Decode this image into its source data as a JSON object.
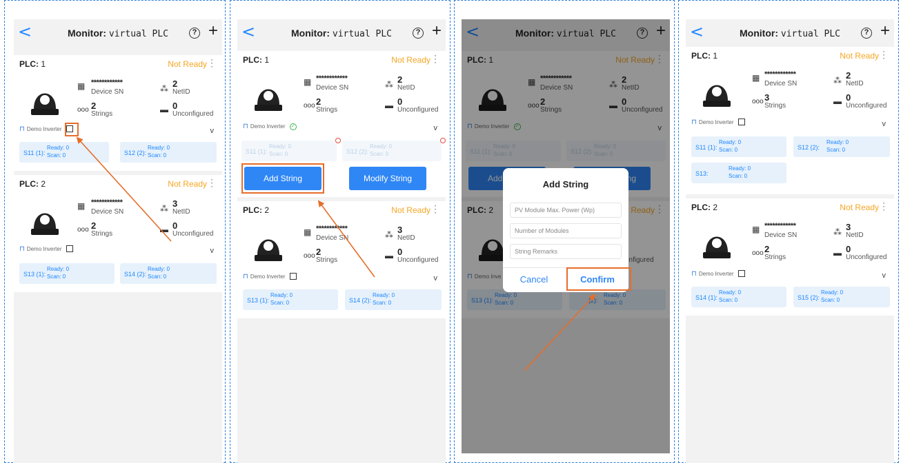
{
  "colors": {
    "accent": "#1e86ff",
    "status": "#f5a623",
    "annotation": "#e66d2a",
    "panel_border": "#2e7dd6"
  },
  "header": {
    "title_prefix": "Monitor:",
    "title_device": "virtual PLC",
    "back_icon": "chevron-left-icon",
    "help_icon": "question-circle-icon",
    "add_icon": "plus-icon",
    "help_glyph": "?",
    "add_glyph": "+",
    "back_glyph": "<"
  },
  "labels": {
    "plc": "PLC:",
    "device_sn": "Device SN",
    "sn_mask": "************",
    "netid": "NetID",
    "strings": "Strings",
    "unconfigured": "Unconfigured",
    "demo_inverter": "Demo Inverter",
    "ready_prefix": "Ready:",
    "scan_prefix": "Scan:",
    "chevron": "v",
    "kebab": "⋮"
  },
  "panels": [
    {
      "plcs": [
        {
          "id": "1",
          "status": "Not Ready",
          "netid": "2",
          "strings": "2",
          "unconfigured": "0",
          "demo_icon": "edit-icon",
          "tiles": [
            {
              "label": "S11 (1):",
              "ready": "Ready: 0",
              "scan": "Scan: 0"
            },
            {
              "label": "S12 (2):",
              "ready": "Ready: 0",
              "scan": "Scan: 0"
            }
          ]
        },
        {
          "id": "2",
          "status": "Not Ready",
          "netid": "3",
          "strings": "2",
          "unconfigured": "0",
          "demo_icon": "edit-icon",
          "tiles": [
            {
              "label": "S13 (1):",
              "ready": "Ready: 0",
              "scan": "Scan: 0"
            },
            {
              "label": "S14 (2):",
              "ready": "Ready: 0",
              "scan": "Scan: 0"
            }
          ]
        }
      ]
    },
    {
      "plcs": [
        {
          "id": "1",
          "status": "Not Ready",
          "netid": "2",
          "strings": "2",
          "unconfigured": "0",
          "demo_icon": "check-circle-icon",
          "tiles": [
            {
              "label": "S11 (1):",
              "ready": "Ready: 0",
              "scan": "Scan: 0"
            },
            {
              "label": "S12 (2):",
              "ready": "Ready: 0",
              "scan": "Scan: 0"
            }
          ],
          "buttons": {
            "add": "Add String",
            "modify": "Modify String"
          }
        },
        {
          "id": "2",
          "status": "Not Ready",
          "netid": "3",
          "strings": "2",
          "unconfigured": "0",
          "demo_icon": "edit-icon",
          "tiles": [
            {
              "label": "S13 (1):",
              "ready": "Ready: 0",
              "scan": "Scan: 0"
            },
            {
              "label": "S14 (2):",
              "ready": "Ready: 0",
              "scan": "Scan: 0"
            }
          ]
        }
      ]
    },
    {
      "plcs": [
        {
          "id": "1",
          "status": "Not Ready",
          "netid": "2",
          "strings": "2",
          "unconfigured": "0",
          "demo_icon": "check-circle-icon",
          "tiles": [
            {
              "label": "S11 (1):",
              "ready": "Ready: 0",
              "scan": "Scan: 0"
            },
            {
              "label": "S12 (2):",
              "ready": "Ready: 0",
              "scan": "Scan: 0"
            }
          ],
          "buttons": {
            "add": "Add String",
            "modify": "Modify String"
          }
        },
        {
          "id": "2",
          "status": "Ready",
          "netid": "",
          "strings": "",
          "unconfigured": "",
          "demo_icon": "edit-icon",
          "tiles": [
            {
              "label": "S13 (1):",
              "ready": "Ready: 0",
              "scan": "Scan: 0"
            },
            {
              "label": "(2):",
              "ready": "Ready: 0",
              "scan": "Scan: 0"
            }
          ],
          "partial_labels": {
            "netid": "ID",
            "unconfigured": "configured",
            "demo": "Demo Inve"
          }
        }
      ],
      "dialog": {
        "title": "Add String",
        "fields": [
          "PV Module Max. Power (Wp)",
          "Number of Modules",
          "String Remarks"
        ],
        "cancel": "Cancel",
        "confirm": "Confirm"
      }
    },
    {
      "plcs": [
        {
          "id": "1",
          "status": "Not Ready",
          "netid": "2",
          "strings": "3",
          "unconfigured": "0",
          "demo_icon": "edit-icon",
          "tiles": [
            {
              "label": "S11 (1):",
              "ready": "Ready: 0",
              "scan": "Scan: 0"
            },
            {
              "label": "S12 (2):",
              "ready": "Ready: 0",
              "scan": "Scan: 0"
            },
            {
              "label": "S13:",
              "ready": "Ready: 0",
              "scan": "Scan: 0"
            }
          ]
        },
        {
          "id": "2",
          "status": "Not Ready",
          "netid": "3",
          "strings": "2",
          "unconfigured": "0",
          "demo_icon": "edit-icon",
          "tiles": [
            {
              "label": "S14 (1):",
              "ready": "Ready: 0",
              "scan": "Scan: 0"
            },
            {
              "label": "S15 (2):",
              "ready": "Ready: 0",
              "scan": "Scan: 0"
            }
          ]
        }
      ]
    }
  ]
}
